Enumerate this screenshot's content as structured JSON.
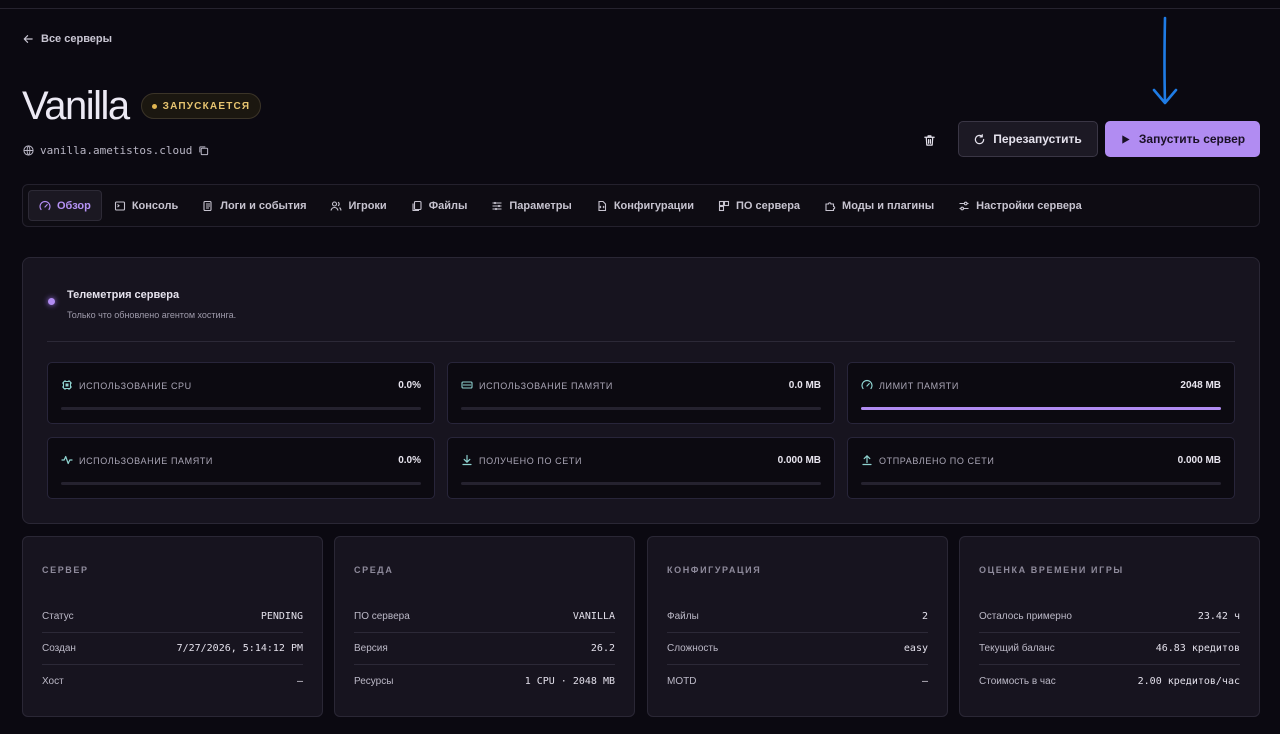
{
  "nav": {
    "back_label": "Все серверы"
  },
  "server": {
    "name": "Vanilla",
    "status": "ЗАПУСКАЕТСЯ",
    "domain": "vanilla.ametistos.cloud"
  },
  "actions": {
    "restart_label": "Перезапустить",
    "start_label": "Запустить сервер"
  },
  "tabs": [
    {
      "label": "Обзор",
      "icon": "gauge-icon",
      "active": true
    },
    {
      "label": "Консоль",
      "icon": "terminal-icon"
    },
    {
      "label": "Логи и события",
      "icon": "log-icon"
    },
    {
      "label": "Игроки",
      "icon": "users-icon"
    },
    {
      "label": "Файлы",
      "icon": "files-icon"
    },
    {
      "label": "Параметры",
      "icon": "sliders-icon"
    },
    {
      "label": "Конфигурации",
      "icon": "config-icon"
    },
    {
      "label": "ПО сервера",
      "icon": "blocks-icon"
    },
    {
      "label": "Моды и плагины",
      "icon": "puzzle-icon"
    },
    {
      "label": "Настройки сервера",
      "icon": "settings-icon"
    }
  ],
  "telemetry": {
    "title": "Телеметрия сервера",
    "subtitle": "Только что обновлено агентом хостинга.",
    "metrics": [
      {
        "label": "использование CPU",
        "value": "0.0%",
        "icon": "cpu-icon",
        "fill": 0
      },
      {
        "label": "использование памяти",
        "value": "0.0 MB",
        "icon": "memory-icon",
        "fill": 0
      },
      {
        "label": "лимит памяти",
        "value": "2048 MB",
        "icon": "gauge-icon",
        "fill": 1
      },
      {
        "label": "использование памяти",
        "value": "0.0%",
        "icon": "activity-icon",
        "fill": 0
      },
      {
        "label": "получено по сети",
        "value": "0.000 MB",
        "icon": "download-icon",
        "fill": 0
      },
      {
        "label": "отправлено по сети",
        "value": "0.000 MB",
        "icon": "upload-icon",
        "fill": 0
      }
    ]
  },
  "cards": [
    {
      "title": "СЕРВЕР",
      "rows": [
        {
          "key": "Статус",
          "value": "PENDING"
        },
        {
          "key": "Создан",
          "value": "7/27/2026, 5:14:12 PM"
        },
        {
          "key": "Хост",
          "value": "—"
        }
      ]
    },
    {
      "title": "СРЕДА",
      "rows": [
        {
          "key": "ПО сервера",
          "value": "VANILLA"
        },
        {
          "key": "Версия",
          "value": "26.2"
        },
        {
          "key": "Ресурсы",
          "value": "1 CPU · 2048 MB"
        }
      ]
    },
    {
      "title": "КОНФИГУРАЦИЯ",
      "rows": [
        {
          "key": "Файлы",
          "value": "2"
        },
        {
          "key": "Сложность",
          "value": "easy"
        },
        {
          "key": "MOTD",
          "value": "—"
        }
      ]
    },
    {
      "title": "ОЦЕНКА ВРЕМЕНИ ИГРЫ",
      "rows": [
        {
          "key": "Осталось примерно",
          "value": "23.42 ч"
        },
        {
          "key": "Текущий баланс",
          "value": "46.83 кредитов"
        },
        {
          "key": "Стоимость в час",
          "value": "2.00 кредитов/час"
        }
      ]
    }
  ],
  "colors": {
    "accent": "#b18cf2",
    "status": "#e0b551",
    "annotation": "#1f7ce6"
  }
}
